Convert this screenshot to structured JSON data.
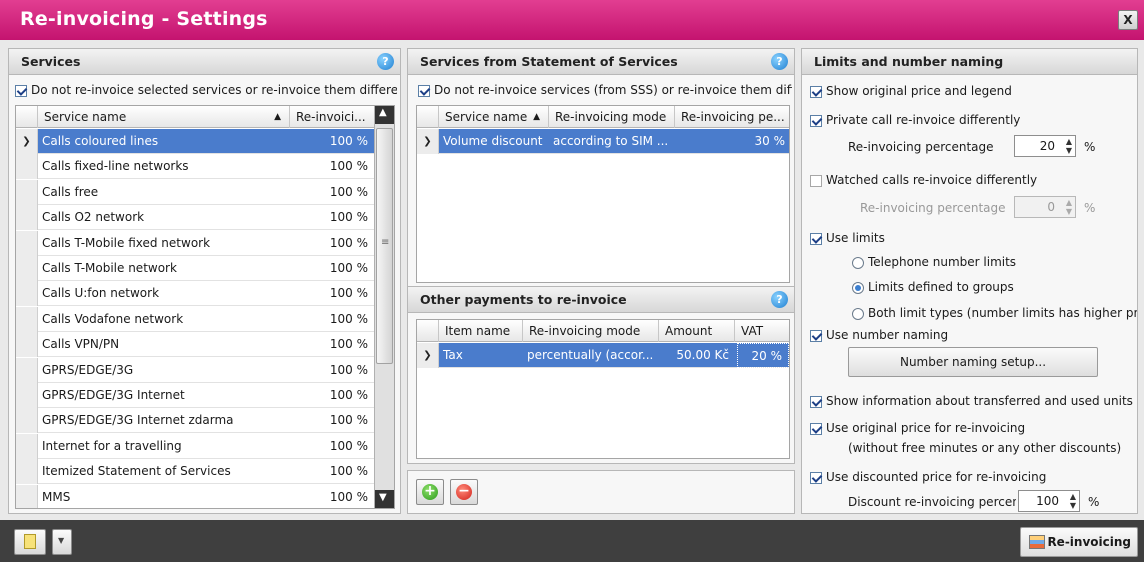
{
  "window": {
    "title": "Re-invoicing - Settings",
    "close_label": "X"
  },
  "services": {
    "header": "Services",
    "checkbox": "Do not re-invoice selected services or re-invoice them differer",
    "columns": [
      "Service name",
      "Re-invoici..."
    ],
    "rows": [
      {
        "name": "Calls coloured lines",
        "value": "100 %"
      },
      {
        "name": "Calls fixed-line networks",
        "value": "100 %"
      },
      {
        "name": "Calls free",
        "value": "100 %"
      },
      {
        "name": "Calls O2 network",
        "value": "100 %"
      },
      {
        "name": "Calls T-Mobile fixed network",
        "value": "100 %"
      },
      {
        "name": "Calls T-Mobile network",
        "value": "100 %"
      },
      {
        "name": "Calls U:fon network",
        "value": "100 %"
      },
      {
        "name": "Calls Vodafone network",
        "value": "100 %"
      },
      {
        "name": "Calls VPN/PN",
        "value": "100 %"
      },
      {
        "name": "GPRS/EDGE/3G",
        "value": "100 %"
      },
      {
        "name": "GPRS/EDGE/3G Internet",
        "value": "100 %"
      },
      {
        "name": "GPRS/EDGE/3G Internet zdarma",
        "value": "100 %"
      },
      {
        "name": "Internet for a travelling",
        "value": "100 %"
      },
      {
        "name": "Itemized Statement of Services",
        "value": "100 %"
      },
      {
        "name": "MMS",
        "value": "100 %"
      }
    ]
  },
  "sss": {
    "header": "Services from Statement of Services",
    "checkbox": "Do not re-invoice services (from SSS) or re-invoice them diffe",
    "columns": [
      "Service name",
      "Re-invoicing mode",
      "Re-invoicing pe..."
    ],
    "rows": [
      {
        "name": "Volume discount",
        "mode": "according to SIM ...",
        "pct": "30 %"
      }
    ]
  },
  "other": {
    "header": "Other payments to re-invoice",
    "columns": [
      "Item name",
      "Re-invoicing mode",
      "Amount",
      "VAT"
    ],
    "rows": [
      {
        "name": "Tax",
        "mode": "percentually (accor...",
        "amount": "50.00 Kč",
        "vat": "20 %"
      }
    ]
  },
  "limits": {
    "header": "Limits and number naming",
    "show_original": "Show original price and legend",
    "private_calls": "Private call re-invoice differently",
    "private_pct_label": "Re-invoicing percentage",
    "private_pct_value": "20",
    "watched_calls": "Watched calls re-invoice differently",
    "watched_pct_label": "Re-invoicing percentage",
    "watched_pct_value": "0",
    "percent_sign": "%",
    "use_limits": "Use limits",
    "radio_phone": "Telephone number limits",
    "radio_groups": "Limits defined to groups",
    "radio_both": "Both limit types (number limits has higher prior",
    "use_naming": "Use number naming",
    "naming_button": "Number naming setup...",
    "show_units": "Show information about transferred and used units",
    "use_original": "Use original price for re-invoicing",
    "use_original_note": "(without free minutes or any other discounts)",
    "use_discounted": "Use discounted price for re-invoicing",
    "discount_label": "Discount re-invoicing percent",
    "discount_value": "100"
  },
  "footer": {
    "reinvoicing_button": "Re-invoicing"
  },
  "colors": {
    "title_bar": "#d12a80",
    "selection": "#4a7ccc"
  }
}
